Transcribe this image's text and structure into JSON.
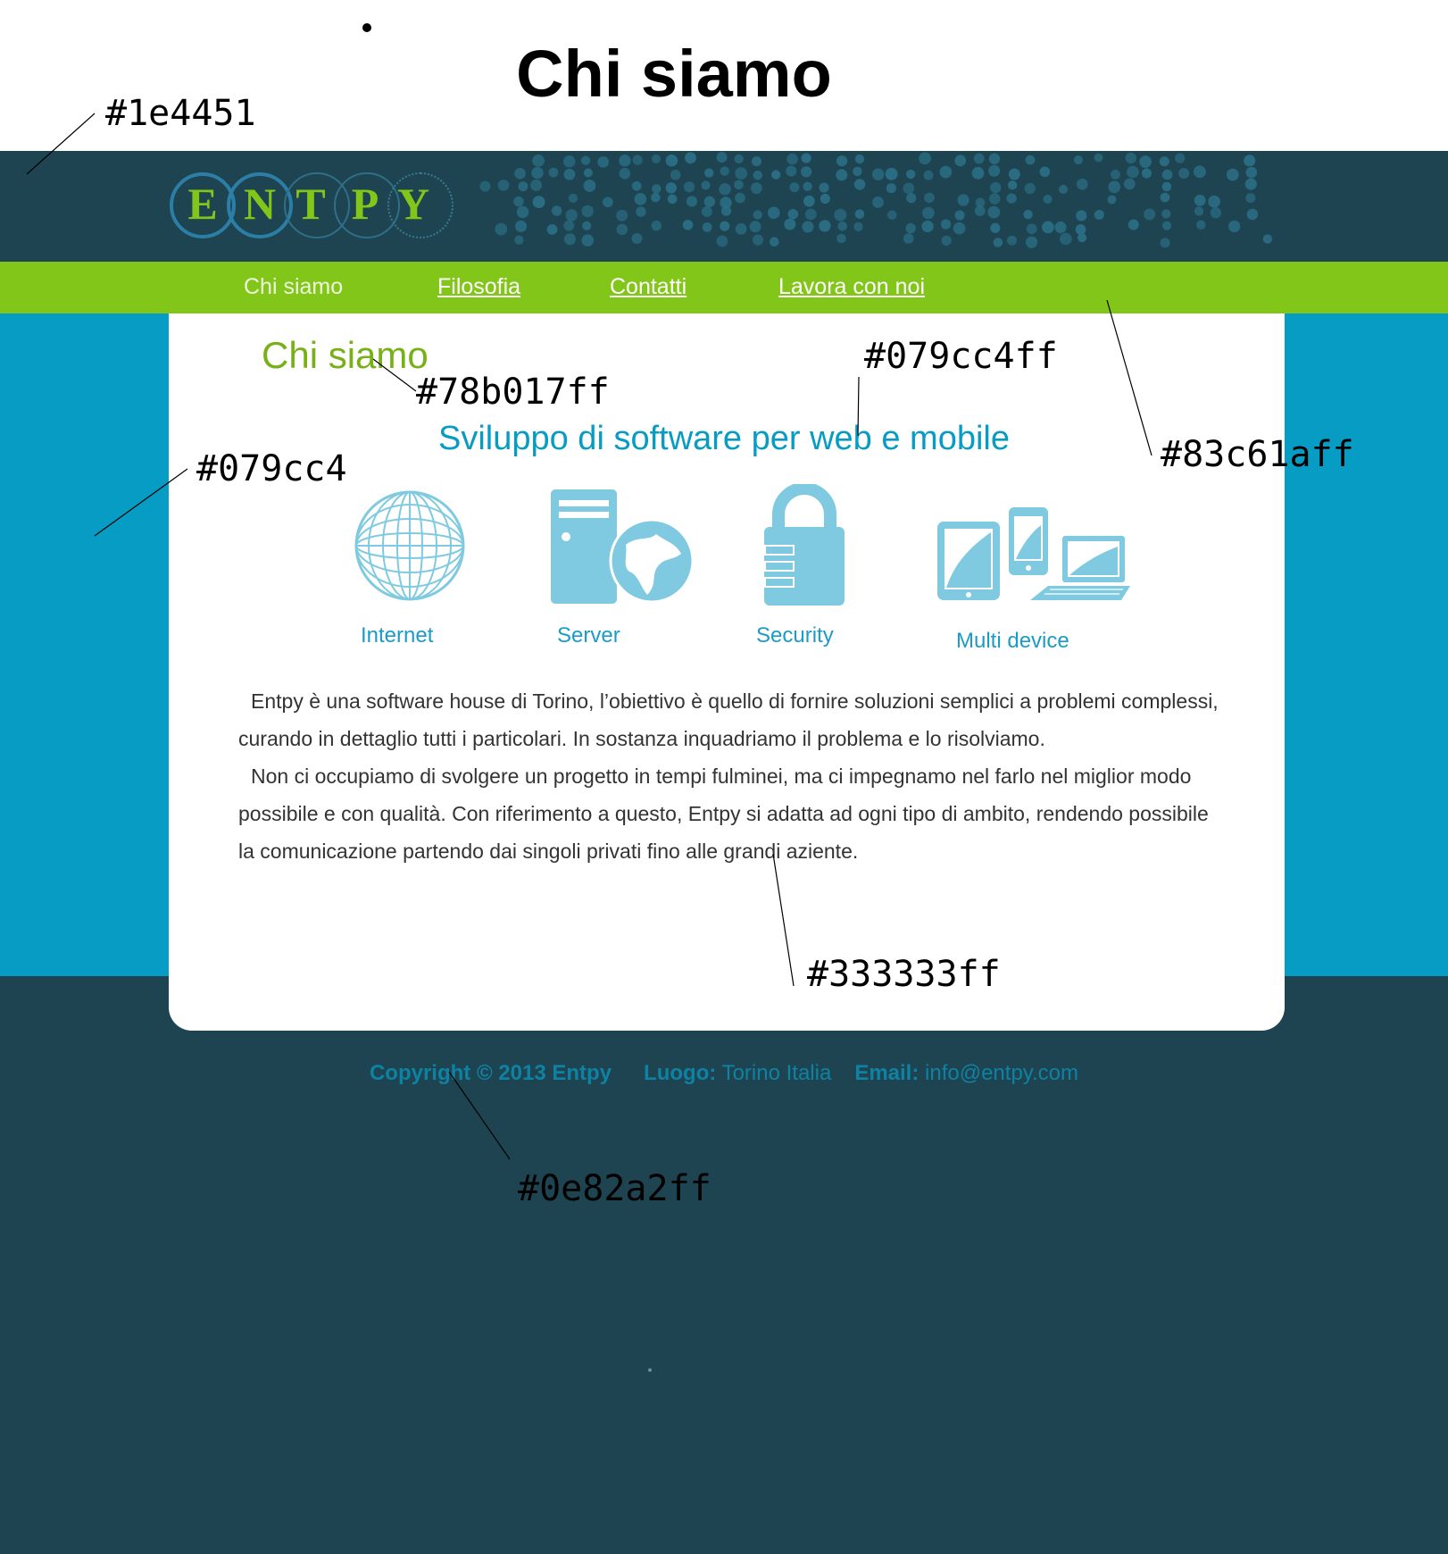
{
  "document": {
    "title": "Chi siamo"
  },
  "site": {
    "logo_letters": [
      "E",
      "N",
      "T",
      "P",
      "Y"
    ],
    "nav": [
      {
        "label": "Chi siamo",
        "active": true
      },
      {
        "label": "Filosofia",
        "active": false
      },
      {
        "label": "Contatti",
        "active": false
      },
      {
        "label": "Lavora con noi",
        "active": false
      }
    ],
    "page_heading": "Chi siamo",
    "subtitle": "Sviluppo di software per web e mobile",
    "features": [
      {
        "label": "Internet",
        "icon": "globe-icon"
      },
      {
        "label": "Server",
        "icon": "server-icon"
      },
      {
        "label": "Security",
        "icon": "lock-icon"
      },
      {
        "label": "Multi device",
        "icon": "devices-icon"
      }
    ],
    "paragraphs": [
      "Entpy è una software house di Torino,  l’obiettivo è quello di fornire soluzioni semplici a problemi complessi, curando in dettaglio tutti i particolari. In sostanza inquadriamo il problema e lo risolviamo.",
      "Non ci occupiamo di svolgere un progetto in tempi fulminei, ma ci impegnamo nel farlo nel miglior modo possibile e con qualità. Con riferimento a questo, Entpy si adatta ad ogni tipo di ambito, rendendo possibile la comunicazione partendo dai singoli privati fino alle grandi aziente."
    ],
    "footer": {
      "copyright": "Copyright © 2013  Entpy",
      "place_label": "Luogo:",
      "place_value": "Torino Italia",
      "email_label": "Email:",
      "email_value": "info@entpy.com"
    }
  },
  "annotations": {
    "header_bg": "#1e4451",
    "heading_color": "#78b017ff",
    "subtitle_color": "#079cc4ff",
    "band_bg": "#079cc4",
    "nav_bg": "#83c61aff",
    "body_text_color": "#333333ff",
    "footer_text_color": "#0e82a2ff"
  },
  "colors": {
    "header": "#1e4451",
    "nav": "#83c61a",
    "band": "#079cc4",
    "heading": "#78b017",
    "subtitle": "#079cc4",
    "icon": "#7fcae0",
    "body_text": "#333333",
    "footer_text": "#0e82a2"
  }
}
